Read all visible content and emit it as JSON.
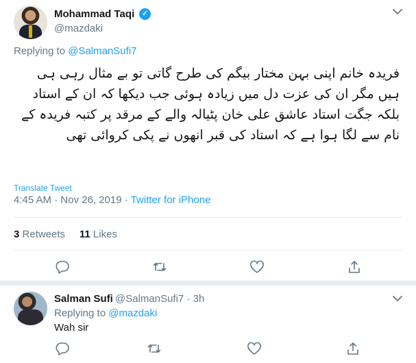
{
  "tweet": {
    "author_name": "Mohammad Taqi",
    "author_handle": "@mazdaki",
    "verified_mark": "✓",
    "replying_prefix": "Replying to",
    "replying_to": "@SalmanSufi7",
    "text": "فریدہ خانم اپنی بہن مختار بیگم کی طرح گاتی تو بے مثال رہی ہی ہیں مگر ان کی عزت دل میں زیادہ ہوئی جب دیکھا کہ ان کے استاد بلکہ جگت استاد عاشق علی خان پٹیالہ والے کے مرقد پر کتبہ فریدہ کے نام سے لگا ہوا ہے کہ استاد کی قبر انھوں نے پکی کروائی تھی",
    "translate_label": "Translate Tweet",
    "time": "4:45 AM",
    "dot": "·",
    "date": "Nov 26, 2019",
    "source": "Twitter for iPhone",
    "retweets_count": "3",
    "retweets_label": "Retweets",
    "likes_count": "11",
    "likes_label": "Likes"
  },
  "reply": {
    "author_name": "Salman Sufi",
    "author_handle": "@SalmanSufi7",
    "dot": "·",
    "time_ago": "3h",
    "replying_prefix": "Replying to",
    "replying_to": "@mazdaki",
    "text": "Wah sir"
  },
  "icons": {
    "reply": "reply-icon",
    "retweet": "retweet-icon",
    "like": "heart-icon",
    "share": "share-icon",
    "more": "chevron-down-icon",
    "verified": "verified-badge-icon"
  },
  "colors": {
    "accent": "#1da1f2",
    "secondary_text": "#657786",
    "divider": "#e6ecf0",
    "icon": "#657786"
  }
}
